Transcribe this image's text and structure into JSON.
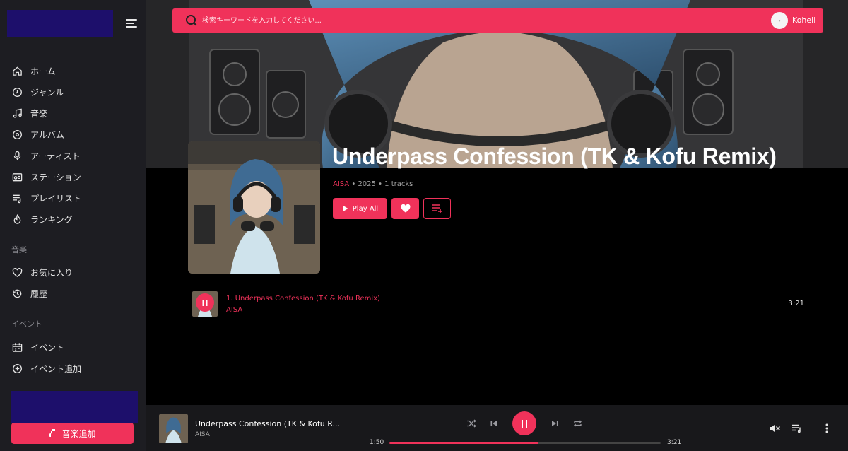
{
  "sidebar": {
    "items": [
      {
        "label": "ホーム",
        "icon": "home-icon"
      },
      {
        "label": "ジャンル",
        "icon": "genre-icon"
      },
      {
        "label": "音楽",
        "icon": "music-note-icon"
      },
      {
        "label": "アルバム",
        "icon": "album-icon"
      },
      {
        "label": "アーティスト",
        "icon": "microphone-icon"
      },
      {
        "label": "ステーション",
        "icon": "radio-icon"
      },
      {
        "label": "プレイリスト",
        "icon": "playlist-icon"
      },
      {
        "label": "ランキング",
        "icon": "flame-icon"
      }
    ],
    "section_music": "音楽",
    "music_items": [
      {
        "label": "お気に入り",
        "icon": "heart-icon"
      },
      {
        "label": "履歴",
        "icon": "history-icon"
      }
    ],
    "section_event": "イベント",
    "event_items": [
      {
        "label": "イベント",
        "icon": "calendar-icon"
      },
      {
        "label": "イベント追加",
        "icon": "plus-circle-icon"
      }
    ],
    "add_music_label": "音楽追加"
  },
  "header": {
    "search_placeholder": "検索キーワードを入力してください...",
    "user_name": "Koheii"
  },
  "album": {
    "title": "Underpass Confession (TK & Kofu Remix)",
    "artist": "AISA",
    "year": "2025",
    "tracks_count": "1 tracks",
    "play_all_label": "Play All"
  },
  "tracks": [
    {
      "title": "1. Underpass Confession (TK & Kofu Remix)",
      "artist": "AISA",
      "duration": "3:21"
    }
  ],
  "player": {
    "title": "Underpass Confession (TK & Kofu R...",
    "artist": "AISA",
    "current_time": "1:50",
    "total_time": "3:21",
    "progress": 0.55
  },
  "colors": {
    "accent": "#f0325a",
    "sidebar_bg": "#1d1d22",
    "brand_block": "#1d0f6b"
  }
}
